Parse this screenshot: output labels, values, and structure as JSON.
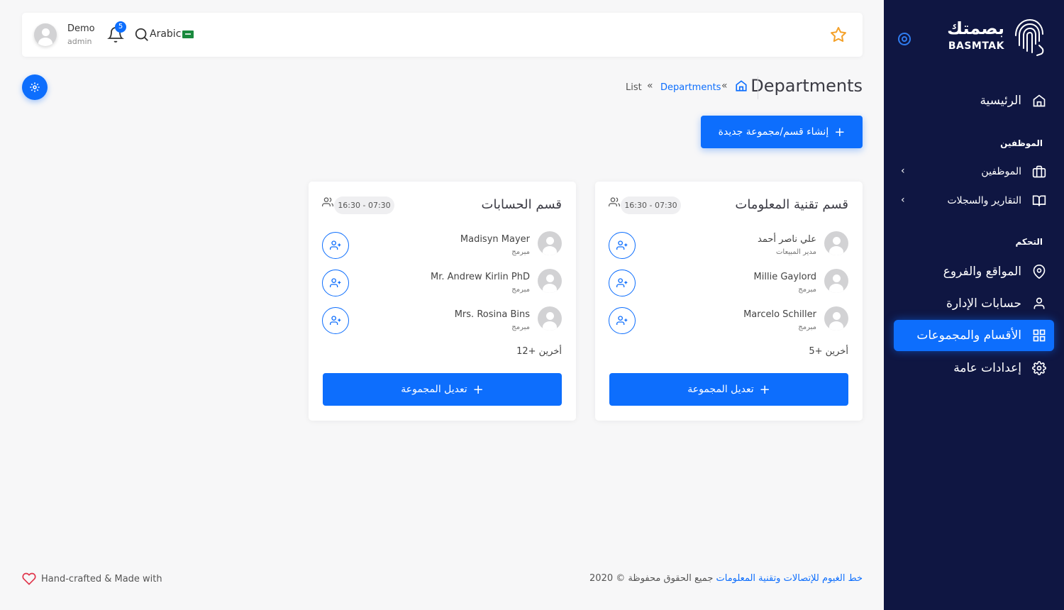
{
  "brand": {
    "name_ar": "بصمتك",
    "name_en": "BASMTAK"
  },
  "sidebar": {
    "home": "الرئيسية",
    "section_employees": "الموظفين",
    "employees": "الموظفين",
    "reports": "التقارير والسجلات",
    "section_control": "التحكم",
    "locations": "المواقع والفروع",
    "admin_accounts": "حسابات الإدارة",
    "departments": "الأقسام والمجموعات",
    "settings": "إعدادات عامة"
  },
  "topbar": {
    "user_name": "Demo",
    "user_role": "admin",
    "notification_count": "5",
    "language": "Arabic"
  },
  "page": {
    "title": "Departments",
    "breadcrumb": [
      "Departments",
      "List"
    ],
    "create_button": "إنشاء قسم/مجموعة جديدة"
  },
  "departments": [
    {
      "name": "قسم تقنية المعلومات",
      "hours": "16:30 - 07:30",
      "members": [
        {
          "name": "علي ناصر أحمد",
          "role": "مدير المبيعات"
        },
        {
          "name": "Millie Gaylord",
          "role": "مبرمج"
        },
        {
          "name": "Marcelo Schiller",
          "role": "مبرمج"
        }
      ],
      "others": "5+ أخرين",
      "edit_button": "تعديل المجموعة"
    },
    {
      "name": "قسم الحسابات",
      "hours": "16:30 - 07:30",
      "members": [
        {
          "name": "Madisyn Mayer",
          "role": "مبرمج"
        },
        {
          "name": "Mr. Andrew Kirlin PhD",
          "role": "مبرمج"
        },
        {
          "name": "Mrs. Rosina Bins",
          "role": "مبرمج"
        }
      ],
      "others": "12+ أخرين",
      "edit_button": "تعديل المجموعة"
    }
  ],
  "footer": {
    "made_with": "Hand-crafted & Made with",
    "copyright_prefix": "جميع الحقوق محفوظة © 2020",
    "company": "خط الغيوم للإتصالات وتقنية المعلومات"
  },
  "colors": {
    "accent": "#0d6efd",
    "sidebar_bg": "#0f1642",
    "page_bg": "#f7f7f8",
    "star": "#f4a12a",
    "heart": "#e0344a"
  }
}
